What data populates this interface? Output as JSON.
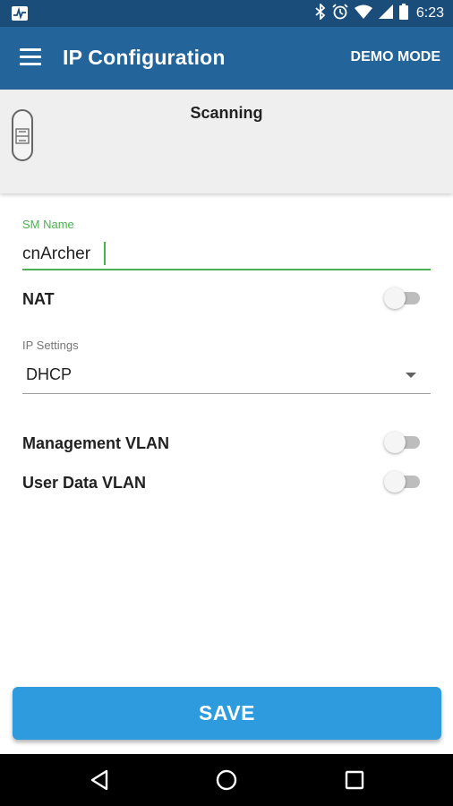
{
  "status_bar": {
    "time": "6:23",
    "icons": [
      "activity-icon",
      "bluetooth-icon",
      "alarm-icon",
      "wifi-icon",
      "signal-icon",
      "battery-icon"
    ]
  },
  "app_bar": {
    "title": "IP Configuration",
    "action_label": "DEMO MODE",
    "color": "#23649b"
  },
  "scan_panel": {
    "status_text": "Scanning"
  },
  "form": {
    "sm_name": {
      "label": "SM Name",
      "value": "cnArcher",
      "accent_color": "#4caf50"
    },
    "nat": {
      "label": "NAT",
      "enabled": false
    },
    "ip_settings": {
      "label": "IP Settings",
      "selected": "DHCP"
    },
    "management_vlan": {
      "label": "Management VLAN",
      "enabled": false
    },
    "user_data_vlan": {
      "label": "User Data VLAN",
      "enabled": false
    }
  },
  "save_button": {
    "label": "SAVE",
    "color": "#2d9bde"
  },
  "nav_bar": {
    "buttons": [
      "back-icon",
      "home-icon",
      "recents-icon"
    ]
  }
}
